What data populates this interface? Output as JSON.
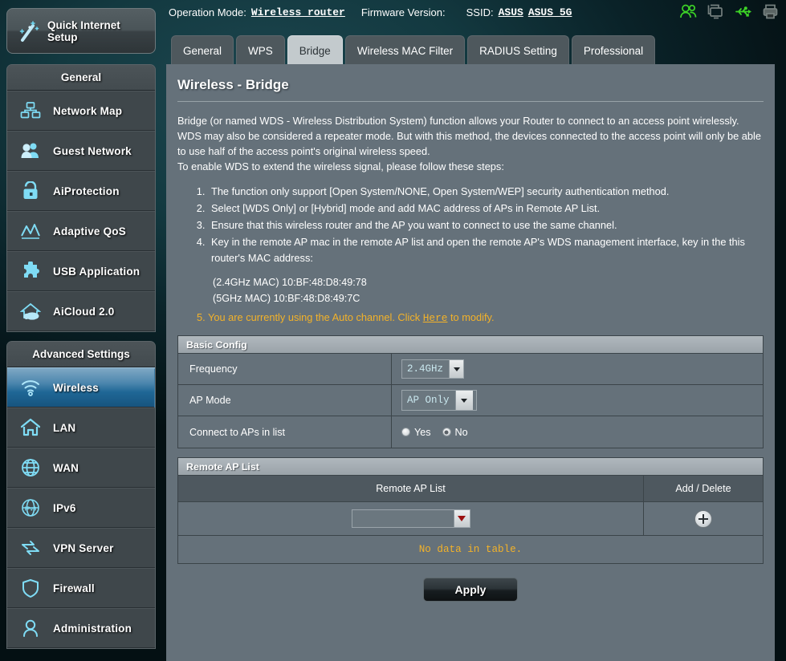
{
  "quick_setup": {
    "label": "Quick Internet\nSetup",
    "icon": "magic-wand-icon"
  },
  "topbar": {
    "operation_mode_label": "Operation Mode:",
    "operation_mode_value": "Wireless router",
    "firmware_label": "Firmware Version:",
    "firmware_value": "",
    "ssid_label": "SSID:",
    "ssid_value_1": "ASUS",
    "ssid_value_2": "ASUS_5G",
    "icons": [
      "users-icon",
      "monitor-icon",
      "usb-icon",
      "printer-icon"
    ],
    "icon_colors": {
      "active": "#3dd427",
      "inactive": "#6f7a7e"
    }
  },
  "sidebar": {
    "general": {
      "header": "General",
      "items": [
        {
          "label": "Network Map",
          "icon": "network-map-icon",
          "active": false
        },
        {
          "label": "Guest Network",
          "icon": "guest-network-icon",
          "active": false
        },
        {
          "label": "AiProtection",
          "icon": "lock-icon",
          "active": false
        },
        {
          "label": "Adaptive QoS",
          "icon": "chart-icon",
          "active": false
        },
        {
          "label": "USB Application",
          "icon": "puzzle-icon",
          "active": false
        },
        {
          "label": "AiCloud 2.0",
          "icon": "cloud-house-icon",
          "active": false
        }
      ]
    },
    "advanced": {
      "header": "Advanced Settings",
      "items": [
        {
          "label": "Wireless",
          "icon": "wifi-icon",
          "active": true
        },
        {
          "label": "LAN",
          "icon": "house-icon",
          "active": false
        },
        {
          "label": "WAN",
          "icon": "globe-icon",
          "active": false
        },
        {
          "label": "IPv6",
          "icon": "ipv6-globe-icon",
          "active": false
        },
        {
          "label": "VPN Server",
          "icon": "vpn-arrows-icon",
          "active": false
        },
        {
          "label": "Firewall",
          "icon": "shield-icon",
          "active": false
        },
        {
          "label": "Administration",
          "icon": "person-icon",
          "active": false
        }
      ]
    }
  },
  "tabs": [
    {
      "label": "General",
      "active": false
    },
    {
      "label": "WPS",
      "active": false
    },
    {
      "label": "Bridge",
      "active": true
    },
    {
      "label": "Wireless MAC Filter",
      "active": false
    },
    {
      "label": "RADIUS Setting",
      "active": false
    },
    {
      "label": "Professional",
      "active": false
    }
  ],
  "page": {
    "title": "Wireless - Bridge",
    "description_1": "Bridge (or named WDS - Wireless Distribution System) function allows your Router to connect to an access point wirelessly. WDS may also be considered a repeater mode. But with this method, the devices connected to the access point will only be able to use half of the access point's original wireless speed.",
    "description_2": "To enable WDS to extend the wireless signal, please follow these steps:",
    "steps": [
      "The function only support [Open System/NONE, Open System/WEP] security authentication method.",
      "Select [WDS Only] or [Hybrid] mode and add MAC address of APs in Remote AP List.",
      "Ensure that this wireless router and the AP you want to connect to use the same channel.",
      "Key in the remote AP mac in the remote AP list and open the remote AP's WDS management interface, key in the this router's MAC address:"
    ],
    "mac_24": "(2.4GHz MAC) 10:BF:48:D8:49:78",
    "mac_5": "(5GHz MAC) 10:BF:48:D8:49:7C",
    "step5_prefix": "5. You are currently using the Auto channel. Click ",
    "step5_link": "Here",
    "step5_suffix": " to modify.",
    "step5_color": "#f3b229"
  },
  "basic_config": {
    "header": "Basic Config",
    "frequency_label": "Frequency",
    "frequency_value": "2.4GHz",
    "ap_mode_label": "AP Mode",
    "ap_mode_value": "AP Only",
    "connect_label": "Connect to APs in list",
    "radio_yes": "Yes",
    "radio_no": "No",
    "radio_selected": "No"
  },
  "remote_ap": {
    "header": "Remote AP List",
    "col_list": "Remote AP List",
    "col_add_delete": "Add / Delete",
    "input_value": "",
    "add_icon": "plus-circle-icon",
    "no_data": "No data in table."
  },
  "apply_button": "Apply"
}
